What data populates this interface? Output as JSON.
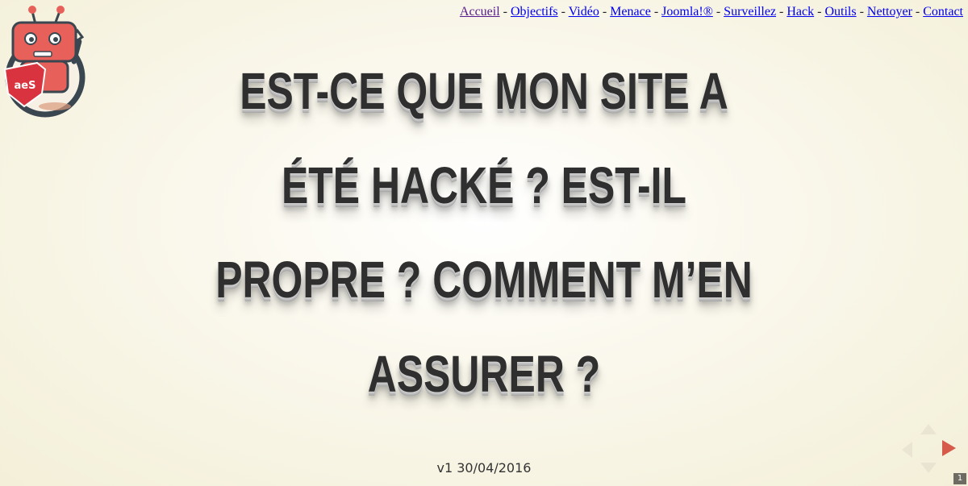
{
  "nav": {
    "separator": "-",
    "items": [
      {
        "label": "Accueil"
      },
      {
        "label": "Objectifs"
      },
      {
        "label": "Vidéo"
      },
      {
        "label": "Menace"
      },
      {
        "label": "Joomla!®"
      },
      {
        "label": "Surveillez"
      },
      {
        "label": "Hack"
      },
      {
        "label": "Outils"
      },
      {
        "label": "Nettoyer"
      },
      {
        "label": "Contact"
      }
    ]
  },
  "logo": {
    "text": "aeS",
    "colors": {
      "robot_red": "#e8605a",
      "ring": "#3a4750",
      "shield": "#d9333f",
      "ground": "#d89a7a"
    }
  },
  "title": {
    "lines": [
      "Est-ce que mon site a",
      "été hacké ? Est-il",
      "propre ? Comment m’en",
      "assurer ?"
    ]
  },
  "version": "v1 30/04/2016",
  "controls": {
    "accent": "#d65a4a",
    "right_enabled": true
  },
  "slide_number": "1"
}
